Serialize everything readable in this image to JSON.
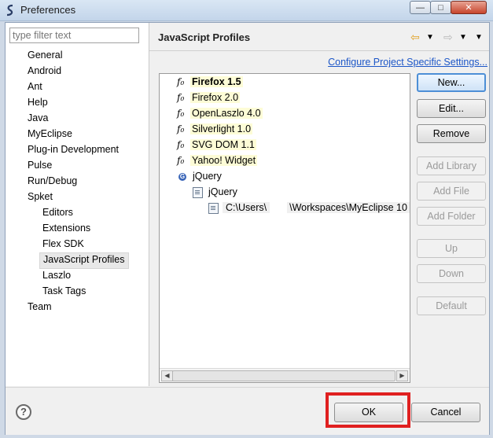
{
  "window": {
    "title": "Preferences"
  },
  "filter": {
    "placeholder": "type filter text"
  },
  "tree": [
    {
      "label": "General",
      "level": 0
    },
    {
      "label": "Android",
      "level": 0
    },
    {
      "label": "Ant",
      "level": 0
    },
    {
      "label": "Help",
      "level": 0
    },
    {
      "label": "Java",
      "level": 0
    },
    {
      "label": "MyEclipse",
      "level": 0
    },
    {
      "label": "Plug-in Development",
      "level": 0
    },
    {
      "label": "Pulse",
      "level": 0
    },
    {
      "label": "Run/Debug",
      "level": 0
    },
    {
      "label": "Spket",
      "level": 0
    },
    {
      "label": "Editors",
      "level": 1
    },
    {
      "label": "Extensions",
      "level": 1
    },
    {
      "label": "Flex SDK",
      "level": 1
    },
    {
      "label": "JavaScript Profiles",
      "level": 1,
      "selected": true
    },
    {
      "label": "Laszlo",
      "level": 1
    },
    {
      "label": "Task Tags",
      "level": 1
    },
    {
      "label": "Team",
      "level": 0
    }
  ],
  "page": {
    "title": "JavaScript Profiles",
    "config_link": "Configure Project Specific Settings..."
  },
  "profiles": [
    {
      "label": "Firefox 1.5",
      "bold": true,
      "icon": "fx-icon"
    },
    {
      "label": "Firefox 2.0",
      "icon": "fx-icon"
    },
    {
      "label": "OpenLaszlo 4.0",
      "icon": "fx-icon"
    },
    {
      "label": "Silverlight 1.0",
      "icon": "fx-icon"
    },
    {
      "label": "SVG DOM 1.1",
      "icon": "fx-icon"
    },
    {
      "label": "Yahoo! Widget",
      "icon": "fx-icon"
    },
    {
      "label": "jQuery",
      "icon": "library-icon"
    },
    {
      "label": "jQuery",
      "icon": "library-file-icon"
    },
    {
      "path_a": "C:\\Users\\",
      "path_b": "\\Workspaces\\MyEclipse 10",
      "icon": "file-icon"
    }
  ],
  "buttons": {
    "new": "New...",
    "edit": "Edit...",
    "remove": "Remove",
    "add_library": "Add Library",
    "add_file": "Add File",
    "add_folder": "Add Folder",
    "up": "Up",
    "down": "Down",
    "default": "Default"
  },
  "footer": {
    "ok": "OK",
    "cancel": "Cancel"
  },
  "colors": {
    "selection_bg": "#e8e8e8",
    "link": "#1c56c7",
    "highlight_box": "#e02020",
    "profile_highlight": "#fdfcd6"
  }
}
